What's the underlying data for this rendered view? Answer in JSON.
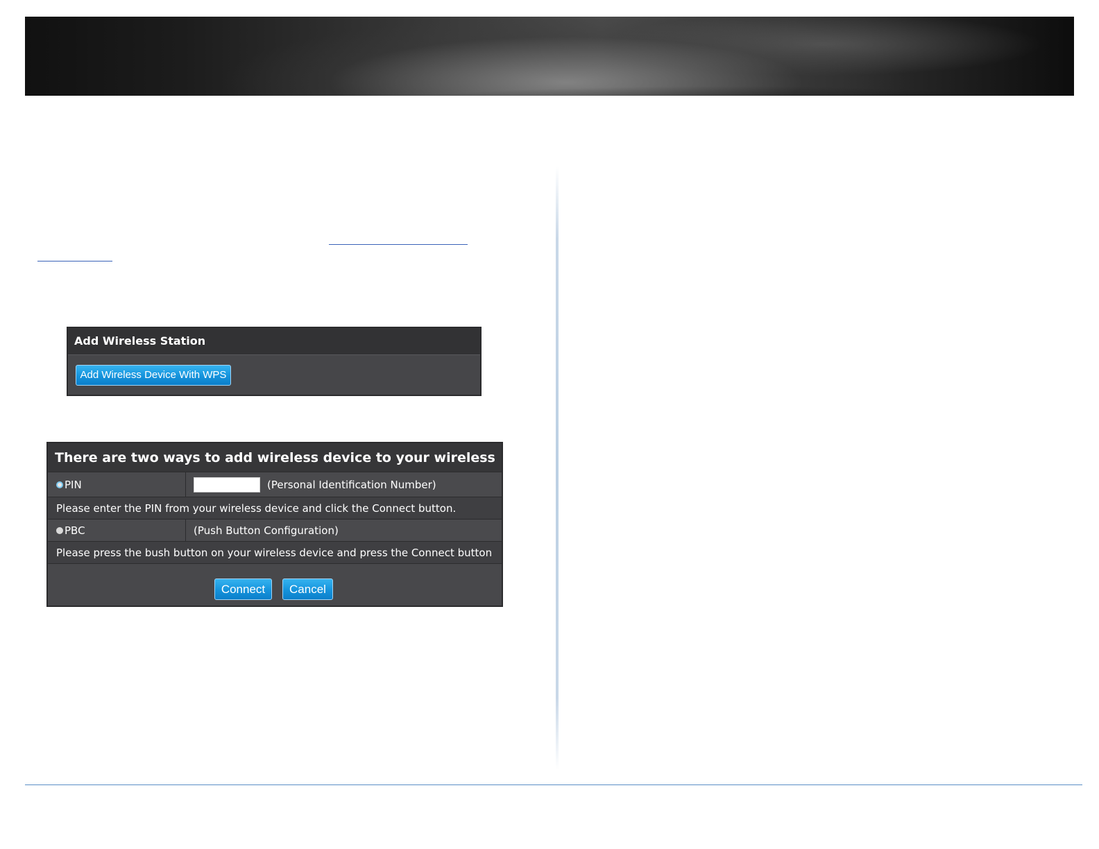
{
  "add_station_panel": {
    "title": "Add Wireless Station",
    "wps_button_label": "Add Wireless Device With WPS"
  },
  "wps_dialog": {
    "title": "There are two ways to add wireless device to your wireless network:",
    "pin": {
      "label": "PIN",
      "selected": true,
      "input_value": "",
      "description": "(Personal Identification Number)",
      "instruction": "Please enter the PIN from your wireless device and click the Connect button."
    },
    "pbc": {
      "label": "PBC",
      "selected": false,
      "description": "(Push Button Configuration)",
      "instruction": "Please press the bush button on your wireless device and press the Connect button"
    },
    "connect_label": "Connect",
    "cancel_label": "Cancel"
  },
  "colors": {
    "button_blue": "#1593dc",
    "panel_gray": "#48484b",
    "rule_blue": "#5b8fc6"
  }
}
